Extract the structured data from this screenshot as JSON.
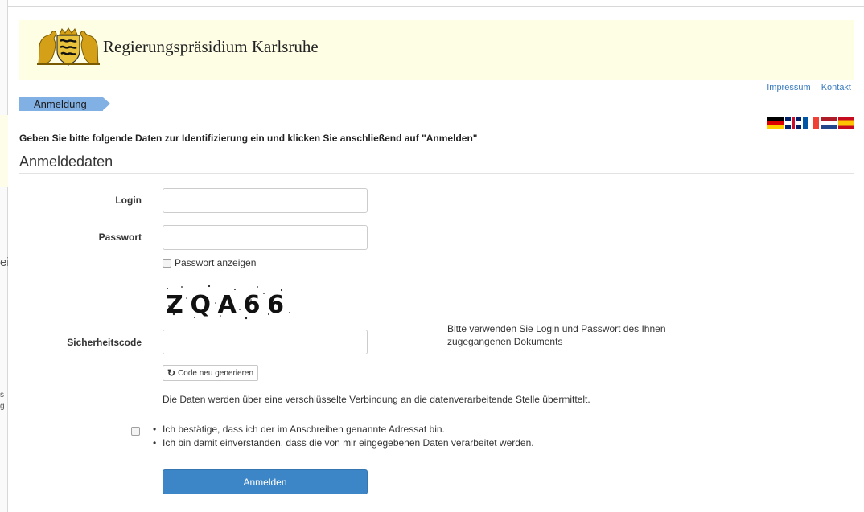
{
  "background_window": {
    "fragments": [
      "ei",
      "s",
      "g",
      ""
    ]
  },
  "header": {
    "site_title": "Regierungspräsidium Karlsruhe",
    "background_color": "#fefee4"
  },
  "top_links": {
    "impressum": "Impressum",
    "kontakt": "Kontakt",
    "link_color": "#3a7bbf"
  },
  "breadcrumb": {
    "label": "Anmeldung",
    "color": "#80b0e4"
  },
  "languages": [
    {
      "icon": "flag-de-icon"
    },
    {
      "icon": "flag-gb-icon"
    },
    {
      "icon": "flag-fr-icon"
    },
    {
      "icon": "flag-nl-icon"
    },
    {
      "icon": "flag-es-icon"
    }
  ],
  "form": {
    "instructions": "Geben Sie bitte folgende Daten zur Identifizierung ein und klicken Sie anschließend auf \"Anmelden\"",
    "section_title": "Anmeldedaten",
    "login_label": "Login",
    "login_value": "",
    "password_label": "Passwort",
    "password_value": "",
    "show_password_label": "Passwort anzeigen",
    "show_password_checked": false,
    "captcha_text": "ZQA66",
    "security_code_label": "Sicherheitscode",
    "security_code_value": "",
    "hint": "Bitte verwenden Sie Login und Passwort des Ihnen zugegangenen Dokuments",
    "regenerate_label": "Code neu generieren",
    "secure_note": "Die Daten werden über eine verschlüsselte Verbindung an die datenverarbeitende Stelle übermittelt.",
    "consent_checked": false,
    "consent_items": [
      "Ich bestätige, dass ich der im Anschreiben genannte Adressat bin.",
      "Ich bin damit einverstanden, dass die von mir eingegebenen Daten verarbeitet werden."
    ],
    "submit_label": "Anmelden",
    "submit_color": "#3c85c6"
  }
}
